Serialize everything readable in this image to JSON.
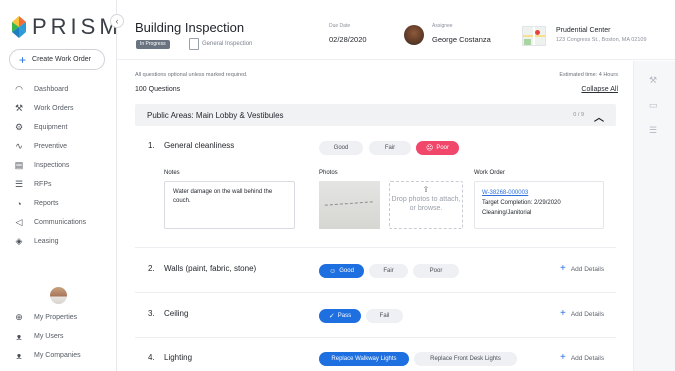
{
  "app": {
    "brand": "PRISM",
    "brand_colors": [
      "#f26b3a",
      "#2a9bd8",
      "#3cb54a",
      "#f9c23c"
    ]
  },
  "sidebar": {
    "collapse_icon": "chevron-left-icon",
    "create_button": "Create Work Order",
    "items": [
      {
        "label": "Dashboard",
        "icon": "speedometer-icon",
        "glyph": "◠"
      },
      {
        "label": "Work Orders",
        "icon": "wrench-icon",
        "glyph": "⚒"
      },
      {
        "label": "Equipment",
        "icon": "gears-icon",
        "glyph": "⚙"
      },
      {
        "label": "Preventive",
        "icon": "wave-icon",
        "glyph": "∿"
      },
      {
        "label": "Inspections",
        "icon": "clipboard-icon",
        "glyph": "▤"
      },
      {
        "label": "RFPs",
        "icon": "list-icon",
        "glyph": "☰"
      },
      {
        "label": "Reports",
        "icon": "chart-icon",
        "glyph": "◔"
      },
      {
        "label": "Communications",
        "icon": "megaphone-icon",
        "glyph": "◁"
      },
      {
        "label": "Leasing",
        "icon": "layers-icon",
        "glyph": "◈"
      }
    ],
    "bottom_items": [
      {
        "label": "My Properties",
        "icon": "globe-icon",
        "glyph": "⊕"
      },
      {
        "label": "My Users",
        "icon": "users-icon",
        "glyph": "ᴥ"
      },
      {
        "label": "My Companies",
        "icon": "companies-icon",
        "glyph": "ᴥ"
      }
    ]
  },
  "header": {
    "title": "Building Inspection",
    "status": "In Progress",
    "type": "General Inspection",
    "due_label": "Due Date",
    "due_value": "02/28/2020",
    "assignee_label": "Assignee",
    "assignee_value": "George Costanza",
    "location_name": "Prudential Center",
    "location_address": "123 Congress St., Boston, MA 02109"
  },
  "main": {
    "note": "All questions optional unless marked required.",
    "questions_count": "100 Questions",
    "estimated_time": "Estimated time: 4 Hours",
    "collapse_all": "Collapse All",
    "section": {
      "title": "Public Areas: Main Lobby & Vestibules",
      "count": "0 / 9",
      "chevron": "︿"
    },
    "questions": [
      {
        "num": "1.",
        "title": "General cleanliness",
        "options": [
          "Good",
          "Fair",
          "Poor"
        ],
        "selected": "Poor",
        "notes_label": "Notes",
        "notes_value": "Water damage on the wall behind the couch.",
        "photos_label": "Photos",
        "drop_text": "Drop photos to attach, or browse.",
        "work_order_label": "Work Order",
        "work_order_id": "W-38268-000003",
        "work_order_target": "Target Completion: 2/29/2020",
        "work_order_category": "Cleaning/Janitorial"
      },
      {
        "num": "2.",
        "title": "Walls (paint, fabric, stone)",
        "options": [
          "Good",
          "Fair",
          "Poor"
        ],
        "selected": "Good",
        "add_details": "Add Details"
      },
      {
        "num": "3.",
        "title": "Ceiling",
        "options": [
          "Pass",
          "Fail"
        ],
        "selected": "Pass",
        "add_details": "Add Details"
      },
      {
        "num": "4.",
        "title": "Lighting",
        "options": [
          "Replace Walkway Lights",
          "Replace Front Desk Lights"
        ],
        "selected": "Replace Walkway Lights",
        "add_details": "Add Details"
      }
    ]
  },
  "rail": {
    "icons": [
      "wrench-icon",
      "image-icon",
      "list-icon"
    ]
  },
  "colors": {
    "poor_selected": "#f0476b",
    "good_selected": "#1e6fe0",
    "link": "#2a6fdb",
    "status_pill": "#6a7480"
  }
}
